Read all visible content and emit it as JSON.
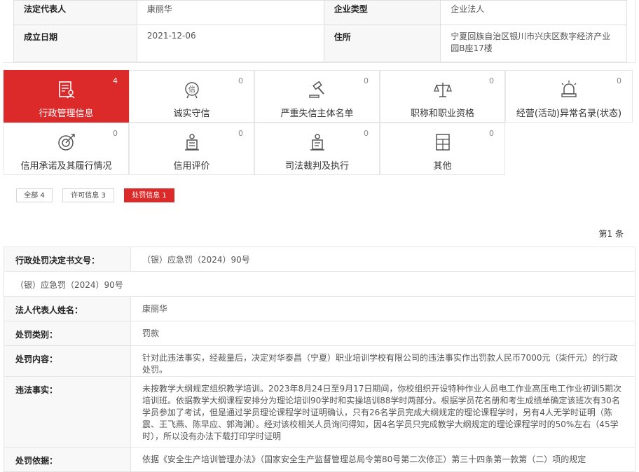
{
  "company_info": {
    "legal_rep_label": "法定代表人",
    "legal_rep_value": "康丽华",
    "company_type_label": "企业类型",
    "company_type_value": "企业法人",
    "est_date_label": "成立日期",
    "est_date_value": "2021-12-06",
    "address_label": "住所",
    "address_value": "宁夏回族自治区银川市兴庆区数字经济产业园B座17楼"
  },
  "categories": [
    {
      "label": "行政管理信息",
      "count": "4",
      "icon": "document-person-icon",
      "active": true
    },
    {
      "label": "诚实守信",
      "count": "0",
      "icon": "honesty-badge-icon",
      "active": false
    },
    {
      "label": "严重失信主体名单",
      "count": "0",
      "icon": "gavel-icon",
      "active": false
    },
    {
      "label": "职称和职业资格",
      "count": "0",
      "icon": "scales-icon",
      "active": false
    },
    {
      "label": "经营(活动)异常名录(状态)",
      "count": "0",
      "icon": "alarm-light-icon",
      "active": false
    },
    {
      "label": "信用承诺及其履行情况",
      "count": "0",
      "icon": "target-icon",
      "active": false
    },
    {
      "label": "信用评价",
      "count": "0",
      "icon": "evaluation-podium-icon",
      "active": false
    },
    {
      "label": "司法裁判及执行",
      "count": "0",
      "icon": "judicial-podium-icon",
      "active": false
    },
    {
      "label": "其他",
      "count": "0",
      "icon": "other-form-icon",
      "active": false
    }
  ],
  "filters": {
    "all": "全部 4",
    "license": "许可信息 3",
    "penalty": "处罚信息 1"
  },
  "page_count": "第1 条",
  "penalty_detail": {
    "decision_no_label": "行政处罚决定书文号：",
    "decision_no_value": "（银）应急罚（2024）90号",
    "decision_no_repeat": "（银）应急罚（2024）90号",
    "legal_rep_label": "法人代表人姓名：",
    "legal_rep_value": "康丽华",
    "category_label": "处罚类别：",
    "category_value": "罚款",
    "content_label": "处罚内容：",
    "content_value": "针对此违法事实，经裁量后，决定对华泰昌（宁夏）职业培训学校有限公司的违法事实作出罚款人民币7000元（柒仟元）的行政处罚。",
    "facts_label": "违法事实：",
    "facts_value": "未按教学大纲规定组织教学培训。2023年8月24日至9月17日期间，你校组织开设特种作业人员电工作业高压电工作业初训5期次培训班。依据教学大纲课程安排分为理论培训90学时和实操培训88学时两部分。根据学员花名册和考生成绩单确定该班次有30名学员参加了考试，但是通过学员理论课程学时证明确认，只有26名学员完成大纲规定的理论课程学时，另有4人无学时证明（陈震、王飞燕、陈早应、郭海渊）。经对该校相关人员询问得知，因4名学员只完成教学大纲规定的理论课程学时的50%左右（45学时），所以没有办法下载打印学时证明",
    "basis_label": "处罚依据：",
    "basis_value": "依据《安全生产培训管理办法》（国家安全生产监督管理总局令第80号第二次修正）第三十四条第一款第（二）项的规定"
  },
  "colors": {
    "accent": "#dc2a2a",
    "label_bg": "#f8f8f8",
    "border": "#e6e6e6"
  }
}
